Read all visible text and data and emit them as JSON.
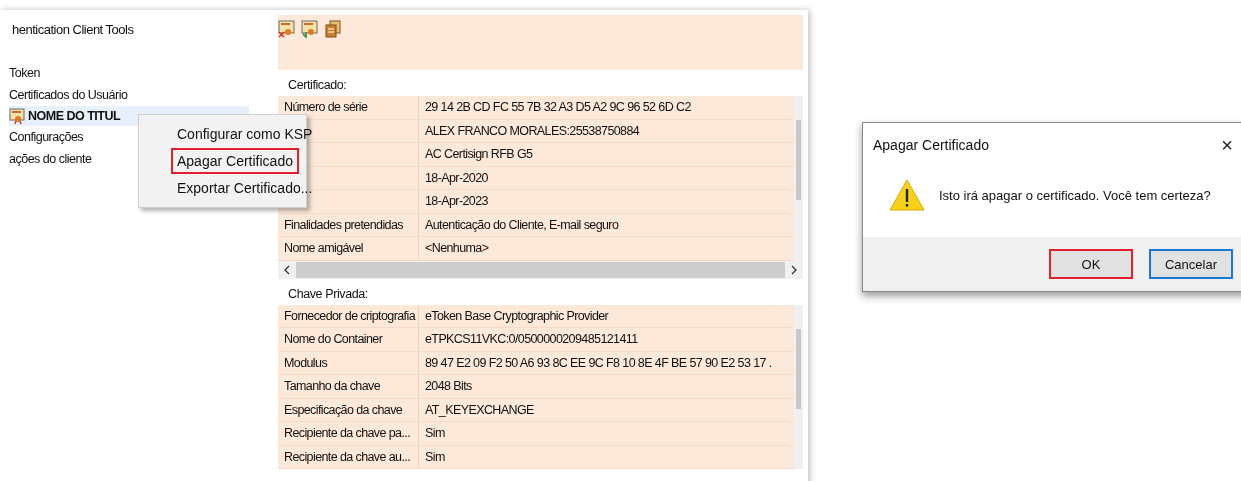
{
  "sidebar": {
    "title": "hentication Client Tools",
    "items": [
      {
        "label": "Token",
        "selected": false,
        "icon": false
      },
      {
        "label": "Certificados do Usuário",
        "selected": false,
        "icon": false
      },
      {
        "label": "NOME DO TITUL",
        "selected": true,
        "icon": true
      },
      {
        "label": "Configurações",
        "selected": false,
        "icon": false
      },
      {
        "label": "ações do cliente",
        "selected": false,
        "icon": false
      }
    ]
  },
  "toolbar": {
    "buttons": [
      {
        "kind": "delete"
      },
      {
        "kind": "import"
      },
      {
        "kind": "copy"
      }
    ]
  },
  "certificate": {
    "heading": "Certificado:",
    "rows": [
      {
        "label": "Número de série",
        "value": "29 14 2B CD FC 55 7B 32 A3 D5 A2 9C 96 52 6D C2"
      },
      {
        "value": "ALEX FRANCO MORALES:25538750884"
      },
      {
        "value": "AC Certisign RFB G5"
      },
      {
        "value": "18-Apr-2020"
      },
      {
        "value": "18-Apr-2023"
      },
      {
        "label": "Finalidades pretendidas",
        "value": "Autenticação do Cliente, E-mail seguro"
      },
      {
        "label": "Nome amigável",
        "value": "<Nenhuma>"
      }
    ]
  },
  "private_key": {
    "heading": "Chave Privada:",
    "rows": [
      {
        "label": "Fornecedor de criptografia",
        "value": "eToken Base Cryptographic Provider"
      },
      {
        "label": "Nome do Container",
        "value": "eTPKCS11VKC:0/0500000209485121411"
      },
      {
        "label": "Modulus",
        "value": "89 47 E2 09 F2 50 A6 93 8C EE 9C F8 10 8E 4F BE 57 90 E2 53 17 ."
      },
      {
        "label": "Tamanho da chave",
        "value": "2048 Bits"
      },
      {
        "label": "Especificação da chave",
        "value": "AT_KEYEXCHANGE"
      },
      {
        "label": "Recipiente da chave pa...",
        "value": "Sim"
      },
      {
        "label": "Recipiente da chave au...",
        "value": "Sim"
      }
    ]
  },
  "context_menu": {
    "items": [
      {
        "label": "Configurar como KSP",
        "highlighted": false
      },
      {
        "label": "Apagar Certificado",
        "highlighted": true
      },
      {
        "label": "Exportar Certificado...",
        "highlighted": false
      }
    ]
  },
  "dialog": {
    "title": "Apagar Certificado",
    "close": "×",
    "message": "Isto irá apagar o certificado. Você tem certeza?",
    "buttons": [
      {
        "label": "OK",
        "highlighted": true,
        "focused": false
      },
      {
        "label": "Cancelar",
        "highlighted": false,
        "focused": true
      }
    ]
  }
}
